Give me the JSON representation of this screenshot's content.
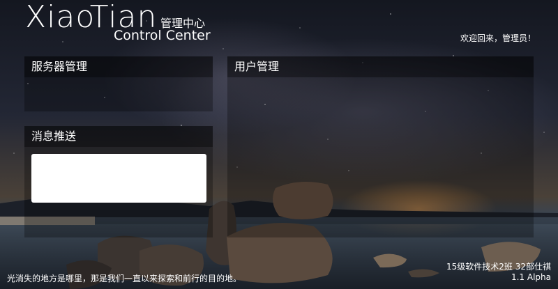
{
  "header": {
    "brand_main": "XiaoTian",
    "brand_cn": "管理中心",
    "brand_sub": "Control Center",
    "welcome": "欢迎回来，管理员！"
  },
  "panels": {
    "server": {
      "title": "服务器管理"
    },
    "message": {
      "title": "消息推送",
      "input_value": ""
    },
    "user": {
      "title": "用户管理"
    }
  },
  "footer": {
    "motto": "光消失的地方是哪里，那是我们一直以来探索和前行的目的地。",
    "credit": "15级软件技术2班 32部仕祺",
    "version": "1.1 Alpha"
  }
}
